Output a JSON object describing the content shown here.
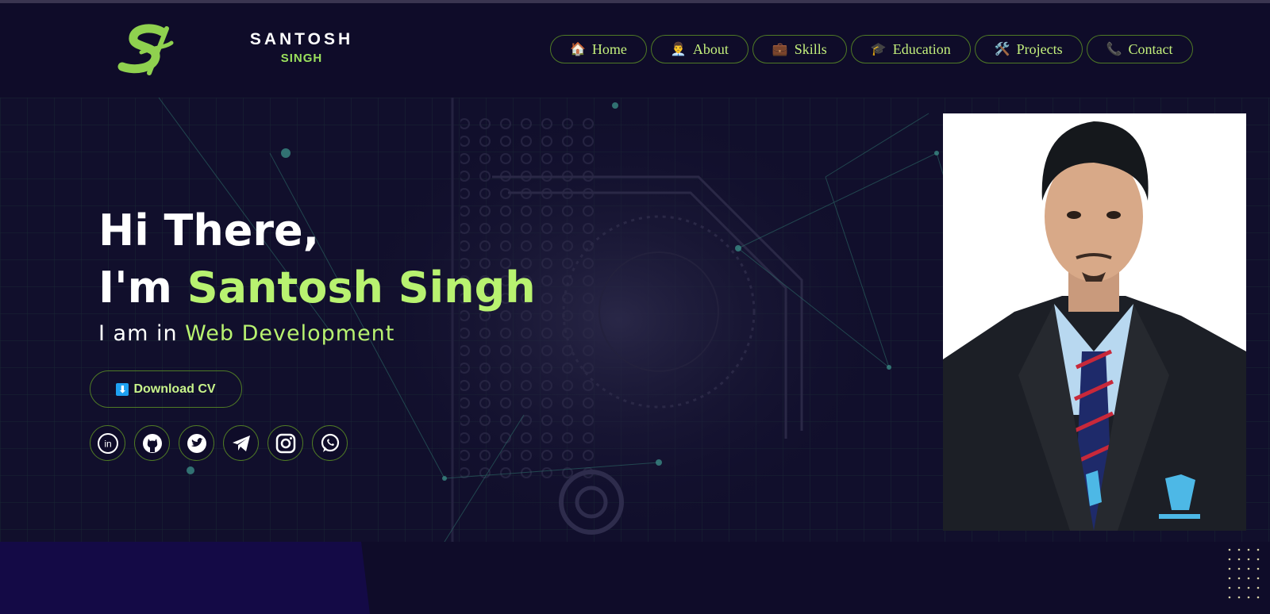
{
  "brand": {
    "first": "SANTOSH",
    "last": "SINGH",
    "logo_icon": "s-monogram-logo-icon"
  },
  "nav": [
    {
      "label": "Home",
      "icon": "🏠"
    },
    {
      "label": "About",
      "icon": "👨‍💼"
    },
    {
      "label": "Skills",
      "icon": "💼"
    },
    {
      "label": "Education",
      "icon": "🎓"
    },
    {
      "label": "Projects",
      "icon": "🛠️"
    },
    {
      "label": "Contact",
      "icon": "📞"
    }
  ],
  "hero": {
    "line1": "Hi There,",
    "line2_prefix": "I'm ",
    "line2_name": "Santosh Singh",
    "sub_prefix": "I am in ",
    "sub_role": "Web Development",
    "cv_icon": "⬇",
    "cv_label": "Download CV"
  },
  "socials": [
    "linkedin-icon",
    "github-icon",
    "twitter-icon",
    "telegram-icon",
    "instagram-icon",
    "whatsapp-icon"
  ],
  "colors": {
    "background": "#0f0c29",
    "accent": "#b8f270",
    "border": "#4f7a25"
  }
}
